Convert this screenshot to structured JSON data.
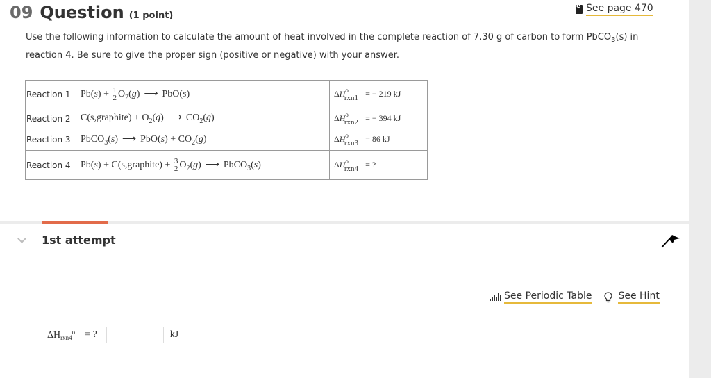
{
  "question": {
    "number": "09",
    "title": "Question",
    "points": "(1 point)",
    "see_page": "See page 470",
    "prompt_part1": "Use the following information to calculate the amount of heat involved in the complete reaction of  7.30 g of carbon to form PbCO",
    "prompt_sub": "3",
    "prompt_part2": "(s) in reaction 4. Be sure to give the proper sign (positive or negative) with your answer."
  },
  "reactions": [
    {
      "label": "Reaction 1",
      "equation": "Pb(s) + 1/2 O2(g) ⟶ PbO(s)",
      "dh_label": "rxn1",
      "dh_value": "= − 219 kJ"
    },
    {
      "label": "Reaction 2",
      "equation": "C(s,graphite) + O2(g) ⟶ CO2(g)",
      "dh_label": "rxn2",
      "dh_value": "= − 394 kJ"
    },
    {
      "label": "Reaction 3",
      "equation": "PbCO3(s) ⟶ PbO(s) + CO2(g)",
      "dh_label": "rxn3",
      "dh_value": "= 86 kJ"
    },
    {
      "label": "Reaction 4",
      "equation": "Pb(s) + C(s,graphite) + 3/2 O2(g) ⟶ PbCO3(s)",
      "dh_label": "rxn4",
      "dh_value": "= ?"
    }
  ],
  "attempt": {
    "label": "1st attempt"
  },
  "tools": {
    "periodic_table": "See Periodic Table",
    "hint": "See Hint"
  },
  "answer": {
    "symbol": "ΔH",
    "subscript": "rxn4",
    "superscript": "o",
    "equals": "= ?",
    "value": "",
    "unit": "kJ"
  },
  "colors": {
    "accent": "#e26b4a",
    "link_underline": "#e6b93b"
  }
}
